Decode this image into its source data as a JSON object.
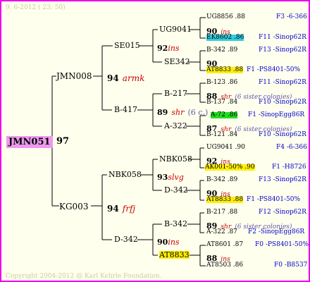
{
  "header": {
    "date": "9. 6-2012 ( 23: 50)"
  },
  "footer": {
    "copyright": "Copyright 2004-2012 @ Karl Kehrle Foundation."
  },
  "watermark": "Karl Kehrle Foundation",
  "root": {
    "name": "JMN051",
    "year": "97"
  },
  "gen1": [
    {
      "name": "JMN008",
      "year": "94",
      "line": "armk"
    },
    {
      "name": "KG003",
      "year": "94",
      "line": "frfj"
    }
  ],
  "gen2": [
    {
      "name": "SE015",
      "year": "92",
      "line": "ins"
    },
    {
      "name": "B-417",
      "year": "89",
      "line": "shr",
      "note": "(6 c.)"
    },
    {
      "name": "NBK058",
      "year": "93",
      "line": "slvg"
    },
    {
      "name": "D-342",
      "year": "90",
      "line": "ins"
    }
  ],
  "gen3": [
    {
      "name": "UG9041",
      "year": "90",
      "line": "ins"
    },
    {
      "name": "SE342",
      "year": "90",
      "line": ""
    },
    {
      "name": "B-217",
      "year": "88",
      "line": "shr",
      "note": "(6 sister colonies)"
    },
    {
      "name": "A-322",
      "year": "87",
      "line": "shr",
      "note": "(6 sister colonies)"
    },
    {
      "name": "NBK058",
      "year": "92",
      "line": "ins"
    },
    {
      "name": "D-342",
      "year": "90",
      "line": "ins"
    },
    {
      "name": "B-342",
      "year": "89",
      "line": "shr",
      "note": "(6 sister colonies)"
    },
    {
      "name": "AT8833",
      "year": "88",
      "line": "ins"
    }
  ],
  "gen4": [
    {
      "left": "UG8856 .88",
      "right": "F3 -6-366"
    },
    {
      "left": "EK8602 .86",
      "right": "F11 -Sinop62R"
    },
    {
      "left": "B-342 .89",
      "right": "F13 -Sinop62R"
    },
    {
      "left": "AT8833 .88",
      "right": "F1 -PS8401-50%"
    },
    {
      "left": "B-123 .86",
      "right": "F11 -Sinop62R"
    },
    {
      "left": "B-137 .84",
      "right": "F10 -Sinop62R"
    },
    {
      "left": "A-72 .86",
      "right": "F1 -SinopEgg86R"
    },
    {
      "left": "B-121 .84",
      "right": "F10 -Sinop62R"
    },
    {
      "left": "UG9041 .90",
      "right": "F4 -6-366"
    },
    {
      "left": "AK001-50% .90",
      "right": "F1 -H8726"
    },
    {
      "left": "B-342 .89",
      "right": "F13 -Sinop62R"
    },
    {
      "left": "AT8833 .88",
      "right": "F1 -PS8401-50%"
    },
    {
      "left": "B-217 .88",
      "right": "F12 -Sinop62R"
    },
    {
      "left": "A-322 .87",
      "right": "F2 -SinopEgg86R"
    },
    {
      "left": "AT8601 .87",
      "right": "F0 -PS8401-50%"
    },
    {
      "left": "AT8503 .86",
      "right": "F0 -B8537"
    }
  ]
}
